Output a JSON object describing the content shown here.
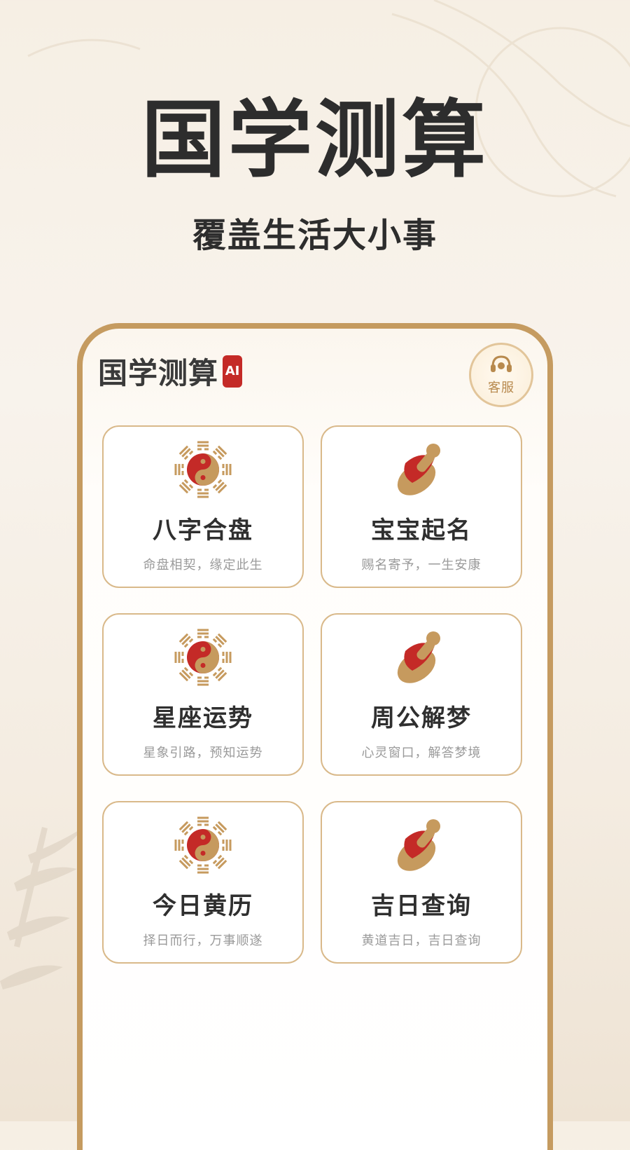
{
  "hero": {
    "title": "国学测算",
    "subtitle": "覆盖生活大小事"
  },
  "app": {
    "title": "国学测算",
    "ai_badge": "AI",
    "customer_service": "客服"
  },
  "cards": [
    {
      "title": "八字合盘",
      "desc": "命盘相契，缘定此生",
      "icon": "bagua-yinyang-icon"
    },
    {
      "title": "宝宝起名",
      "desc": "赐名寄予，一生安康",
      "icon": "seal-stamp-icon"
    },
    {
      "title": "星座运势",
      "desc": "星象引路，预知运势",
      "icon": "bagua-yinyang-icon"
    },
    {
      "title": "周公解梦",
      "desc": "心灵窗口，解答梦境",
      "icon": "seal-stamp-icon"
    },
    {
      "title": "今日黄历",
      "desc": "择日而行，万事顺遂",
      "icon": "bagua-yinyang-icon"
    },
    {
      "title": "吉日查询",
      "desc": "黄道吉日，吉日查询",
      "icon": "seal-stamp-icon"
    }
  ],
  "colors": {
    "accent_gold": "#c59b60",
    "accent_red": "#c42a27",
    "text_dark": "#2d2d2d",
    "text_muted": "#9a9a9a"
  }
}
